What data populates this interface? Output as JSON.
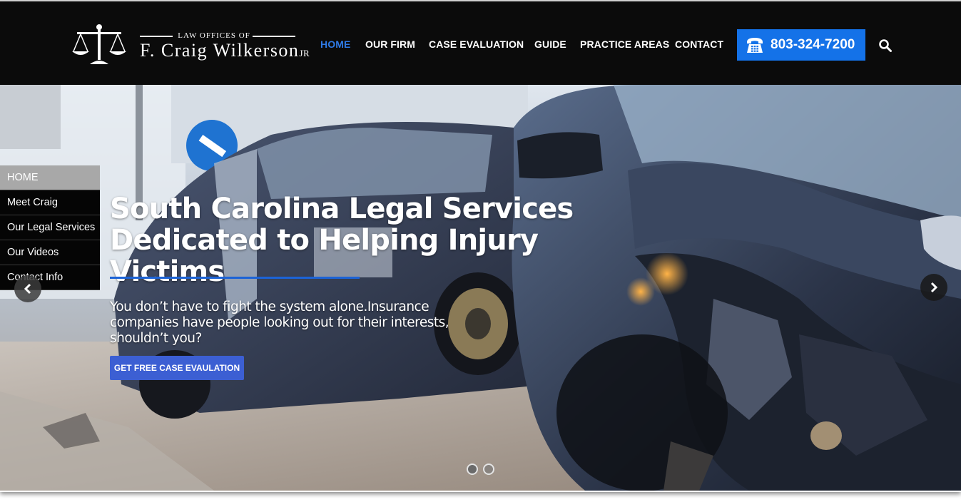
{
  "logo": {
    "top_line": "LAW OFFICES OF",
    "name": "F. Craig Wilkerson",
    "suffix": "JR"
  },
  "nav": {
    "items": [
      {
        "label": "HOME",
        "active": true
      },
      {
        "label": "OUR FIRM"
      },
      {
        "label": "CASE EVALUATION"
      },
      {
        "label": "GUIDE"
      },
      {
        "label": "PRACTICE AREAS"
      },
      {
        "label": "CONTACT"
      }
    ]
  },
  "phone": {
    "number": "803-324-7200",
    "icon": "phone-icon"
  },
  "search": {
    "icon": "search-icon"
  },
  "side_menu": {
    "items": [
      {
        "label": "HOME",
        "active": true
      },
      {
        "label": "Meet Craig"
      },
      {
        "label": "Our Legal Services"
      },
      {
        "label": "Our Videos"
      },
      {
        "label": "Contact Info"
      }
    ]
  },
  "hero": {
    "headline_line1": "South Carolina Legal Services",
    "headline_line2": "Dedicated to Helping Injury Victims",
    "subtext": "You don’t have to fight the system alone.Insurance companies have people looking out for their interests, shouldn’t you?",
    "cta_label": "GET FREE CASE EVAULATION",
    "slide_count": 2,
    "active_slide": 1
  },
  "colors": {
    "header_bg": "#0b0b0b",
    "accent": "#1472e8",
    "active_nav": "#2f7ae5",
    "cta": "#3c5fd3"
  }
}
